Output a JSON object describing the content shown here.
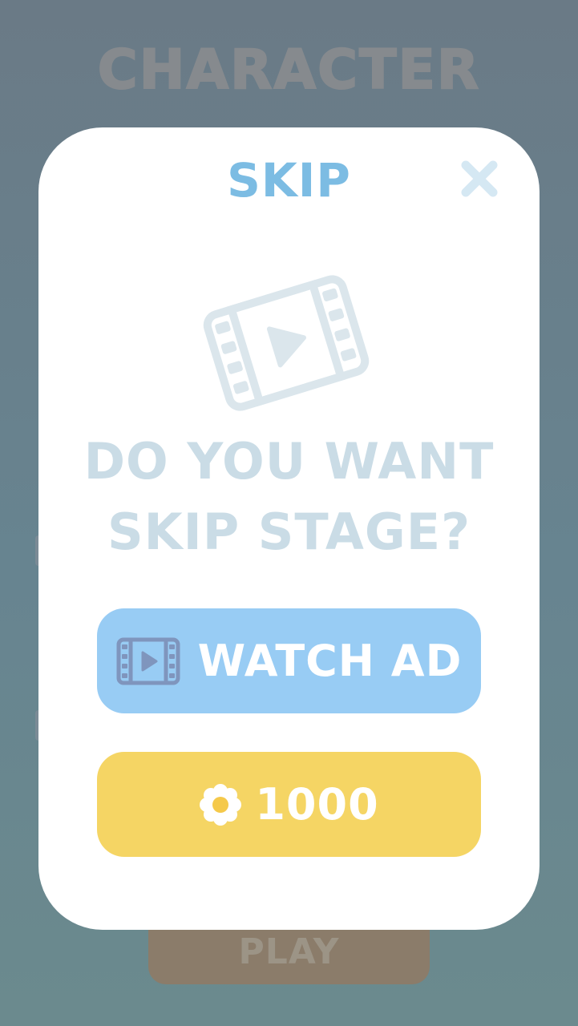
{
  "background": {
    "screen_title": "CHARACTER",
    "play_label": "PLAY"
  },
  "dialog": {
    "title": "SKIP",
    "close_icon": "close-icon",
    "hero_icon": "film-play-icon",
    "question_line1": "DO YOU WANT",
    "question_line2": "SKIP STAGE?",
    "watch_ad": {
      "label": "WATCH AD",
      "icon": "film-play-icon"
    },
    "coins": {
      "label": "1000",
      "icon": "flower-coin-icon"
    }
  },
  "colors": {
    "title": "#7cbce3",
    "question": "#cadce6",
    "watch_button": "#98ccf4",
    "coin_button": "#f5d564",
    "film_icon_small": "#7f95bd",
    "film_icon_big": "#dbe6ec"
  }
}
